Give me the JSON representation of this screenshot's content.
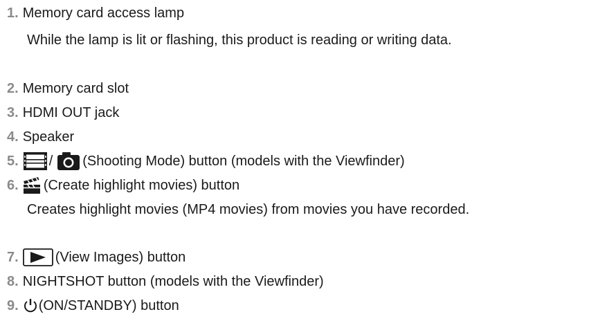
{
  "items": [
    {
      "number": "1.",
      "title": "Memory card access lamp",
      "description": "While the lamp is lit or flashing, this product is reading or writing data."
    },
    {
      "number": "2.",
      "title": "Memory card slot"
    },
    {
      "number": "3.",
      "title": "HDMI OUT jack"
    },
    {
      "number": "4.",
      "title": "Speaker"
    },
    {
      "number": "5.",
      "separator": "/",
      "title": "(Shooting Mode) button (models with the Viewfinder)",
      "icons": [
        "movie-film-icon",
        "camera-icon"
      ]
    },
    {
      "number": "6.",
      "title": "(Create highlight movies) button",
      "description": "Creates highlight movies (MP4 movies) from movies you have recorded.",
      "icons": [
        "clapperboard-icon"
      ]
    },
    {
      "number": "7.",
      "title": "(View Images) button",
      "icons": [
        "play-button-icon"
      ]
    },
    {
      "number": "8.",
      "title": "NIGHTSHOT button (models with the Viewfinder)"
    },
    {
      "number": "9.",
      "title": "(ON/STANDBY) button",
      "icons": [
        "power-icon"
      ]
    }
  ],
  "colors": {
    "number": "#8a8a8a",
    "text": "#1a1a1a",
    "icon": "#1a1a1a"
  }
}
